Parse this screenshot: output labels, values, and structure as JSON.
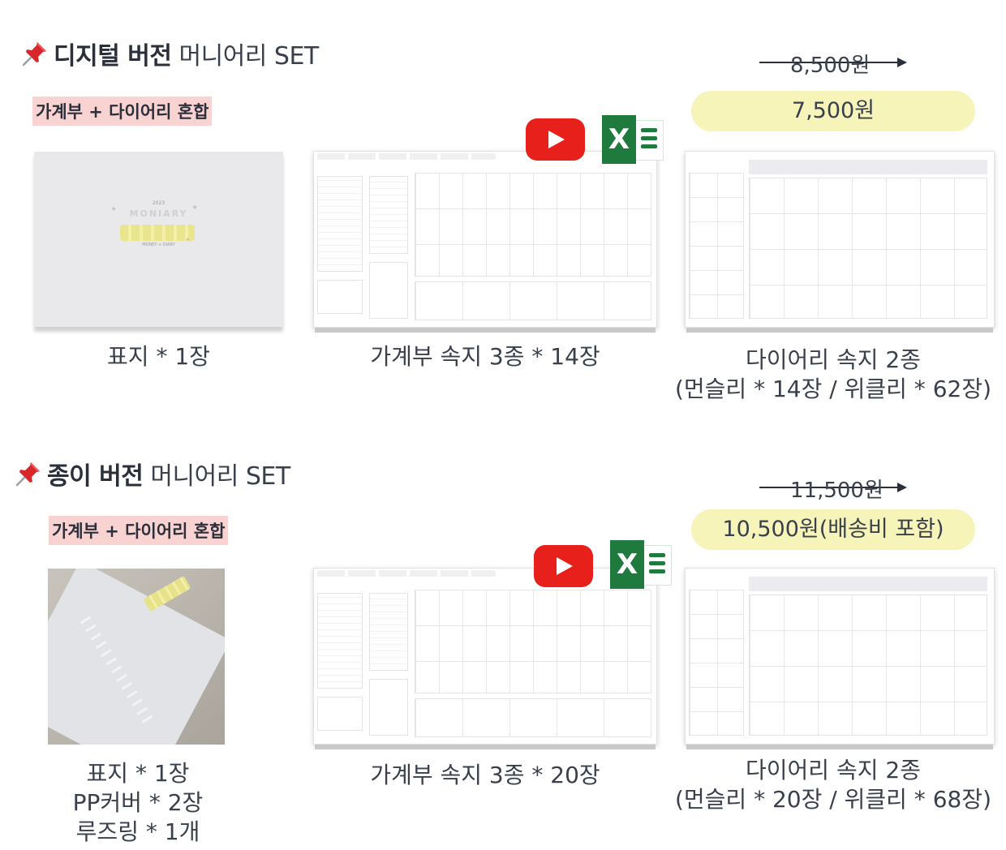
{
  "colors": {
    "accent_pink": "#f9d2d2",
    "price_yellow": "#f6f4b8",
    "youtube_red": "#e8201c",
    "excel_green": "#1f7a3d",
    "text": "#2b2f3a"
  },
  "digital": {
    "title_bold": "디지털 버전",
    "title_light": "머니어리 SET",
    "tag": "가계부 + 다이어리 혼합",
    "old_price": "8,500원",
    "price": "7,500원",
    "cover_year": "2023",
    "cover_brand": "MONIARY",
    "cover_sub": "MONEY + DIARY",
    "caption_cover": "표지 * 1장",
    "caption_ledger": "가계부 속지 3종 * 14장",
    "caption_diary_1": "다이어리 속지 2종",
    "caption_diary_2": "(먼슬리 * 14장 / 위클리 * 62장)"
  },
  "paper": {
    "title_bold": "종이 버전",
    "title_light": "머니어리 SET",
    "tag": "가계부 + 다이어리 혼합",
    "old_price": "11,500원",
    "price": "10,500원(배송비 포함)",
    "caption_cover_1": "표지 * 1장",
    "caption_cover_2": "PP커버 * 2장",
    "caption_cover_3": "루즈링 * 1개",
    "caption_ledger": "가계부 속지 3종 * 20장",
    "caption_diary_1": "다이어리 속지 2종",
    "caption_diary_2": "(먼슬리 * 20장 / 위클리 * 68장)"
  },
  "icons": {
    "pin": "pushpin-icon",
    "youtube": "youtube-icon",
    "excel": "excel-icon"
  }
}
